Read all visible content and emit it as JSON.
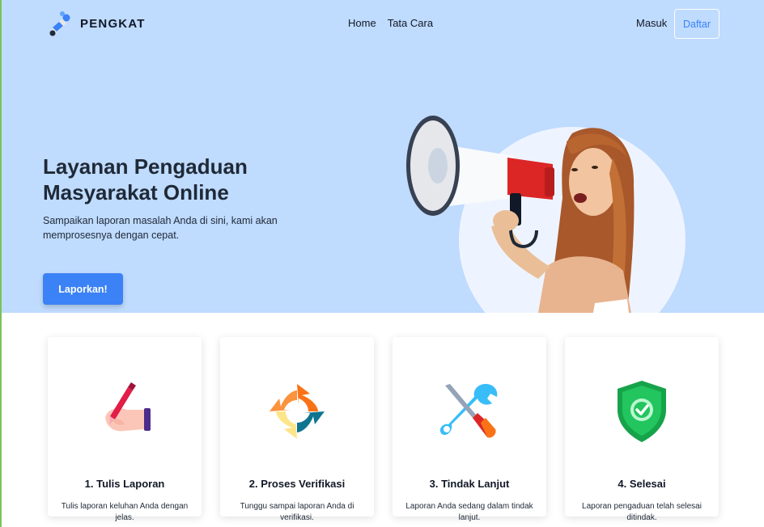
{
  "navbar": {
    "brand": "PENGKAT",
    "links": [
      "Home",
      "Tata Cara"
    ],
    "login": "Masuk",
    "register": "Daftar"
  },
  "hero": {
    "title": "Layanan Pengaduan Masyarakat Online",
    "subtitle": "Sampaikan laporan masalah Anda di sini, kami akan memprosesnya dengan cepat.",
    "cta": "Laporkan!"
  },
  "steps": [
    {
      "title": "1. Tulis Laporan",
      "text": "Tulis laporan keluhan Anda dengan jelas.",
      "icon": "pen-hand-icon"
    },
    {
      "title": "2. Proses Verifikasi",
      "text": "Tunggu sampai laporan Anda di verifikasi.",
      "icon": "refresh-arrows-icon"
    },
    {
      "title": "3. Tindak Lanjut",
      "text": "Laporan Anda sedang dalam tindak lanjut.",
      "icon": "tools-icon"
    },
    {
      "title": "4. Selesai",
      "text": "Laporan pengaduan telah selesai ditindak.",
      "icon": "shield-check-icon"
    }
  ],
  "colors": {
    "hero_bg": "#bfdbfe",
    "primary": "#3b82f6",
    "text": "#1f2937"
  }
}
